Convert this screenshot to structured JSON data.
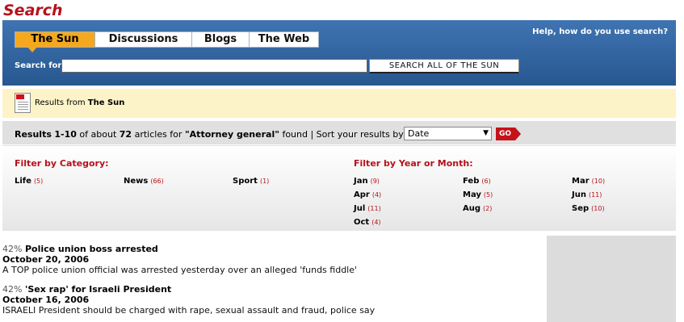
{
  "page_title": "Search",
  "search_panel": {
    "tabs": [
      {
        "label": "The Sun",
        "active": true
      },
      {
        "label": "Discussions",
        "active": false
      },
      {
        "label": "Blogs",
        "active": false
      },
      {
        "label": "The Web",
        "active": false
      }
    ],
    "help_link": "Help, how do you use search?",
    "search_label": "Search for:",
    "search_value": "",
    "search_button": "SEARCH ALL OF THE SUN"
  },
  "source_bar": {
    "prefix": "Results from",
    "source": "The Sun"
  },
  "results_bar": {
    "results_prefix": "Results",
    "range": "1-10",
    "of_about": "of about",
    "count": "72",
    "articles_for": "articles for",
    "query": "\"Attorney general\"",
    "found": "found",
    "sort_label": "| Sort your results by:",
    "sort_value": "Date",
    "go_label": "GO"
  },
  "filters": {
    "category_heading": "Filter by Category:",
    "categories": [
      {
        "label": "Life",
        "count": "(5)"
      },
      {
        "label": "News",
        "count": "(66)"
      },
      {
        "label": "Sport",
        "count": "(1)"
      }
    ],
    "date_heading": "Filter by Year or Month:",
    "months": [
      {
        "label": "Jan",
        "count": "(9)"
      },
      {
        "label": "Feb",
        "count": "(6)"
      },
      {
        "label": "Mar",
        "count": "(10)"
      },
      {
        "label": "Apr",
        "count": "(4)"
      },
      {
        "label": "May",
        "count": "(5)"
      },
      {
        "label": "Jun",
        "count": "(11)"
      },
      {
        "label": "Jul",
        "count": "(11)"
      },
      {
        "label": "Aug",
        "count": "(2)"
      },
      {
        "label": "Sep",
        "count": "(10)"
      },
      {
        "label": "Oct",
        "count": "(4)"
      }
    ]
  },
  "results": [
    {
      "relevance": "42%",
      "title": "Police union boss arrested",
      "date": "October 20, 2006",
      "snippet": "A TOP police union official was arrested yesterday over an alleged 'funds fiddle'"
    },
    {
      "relevance": "42%",
      "title": "'Sex rap' for Israeli President",
      "date": "October 16, 2006",
      "snippet": "ISRAELI President should be charged with rape, sexual assault and fraud, police say"
    }
  ],
  "colors": {
    "brand_red": "#b5121b",
    "panel_blue": "#2f64a0",
    "active_tab": "#f5a81e",
    "source_bar": "#fdf3c8"
  }
}
